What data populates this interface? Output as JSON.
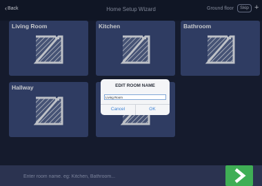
{
  "header": {
    "back_label": "Back",
    "title": "Home Setup Wizard",
    "floor_label": "Ground floor",
    "skip_label": "Skip",
    "add_label": "+"
  },
  "rooms": [
    {
      "name": "Living Room"
    },
    {
      "name": "Kitchen"
    },
    {
      "name": "Bathroom"
    },
    {
      "name": "Hallway"
    },
    {
      "name": ""
    }
  ],
  "dialog": {
    "title": "EDIT ROOM NAME",
    "input_value": "Living Room",
    "cancel_label": "Cancel",
    "ok_label": "OK"
  },
  "footer": {
    "placeholder": "Enter room name. eg: Kitchen, Bathroom..."
  },
  "icons": {
    "back": "chevron-left-icon",
    "room": "room-floorplan-icon",
    "go": "chevron-right-icon"
  },
  "colors": {
    "background": "#1a2238",
    "tile": "#3a4a78",
    "accent": "#3c82d6",
    "go_button": "#3fae55"
  }
}
